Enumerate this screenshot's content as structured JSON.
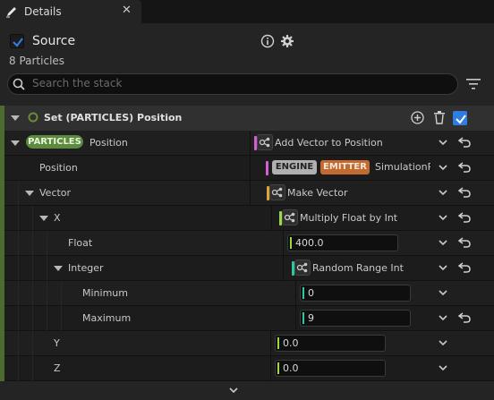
{
  "tab": {
    "label": "Details",
    "icon": "pencil-icon",
    "close": "✕"
  },
  "source": {
    "title": "Source",
    "subtitle": "8 Particles",
    "enabled": true
  },
  "toolbar": {
    "info_icon": "info-icon",
    "settings_icon": "gear-icon",
    "filter_icon": "filter-icon"
  },
  "search": {
    "placeholder": "Search the stack"
  },
  "module": {
    "title": "Set (PARTICLES) Position",
    "enabled": true
  },
  "rows": {
    "particles": {
      "tag": "PARTICLES",
      "label": "Position",
      "value": "Add Vector to Position"
    },
    "position": {
      "label": "Position",
      "tag_engine": "ENGINE",
      "tag_emitter": "EMITTER",
      "value": "SimulationP"
    },
    "vector": {
      "label": "Vector",
      "value": "Make Vector"
    },
    "x": {
      "label": "X",
      "value": "Multiply Float by Int"
    },
    "float": {
      "label": "Float",
      "value": "400.0"
    },
    "integer": {
      "label": "Integer",
      "value": "Random Range Int"
    },
    "minimum": {
      "label": "Minimum",
      "value": "0"
    },
    "maximum": {
      "label": "Maximum",
      "value": "9"
    },
    "y": {
      "label": "Y",
      "value": "0.0"
    },
    "z": {
      "label": "Z",
      "value": "0.0"
    }
  },
  "colors": {
    "accent_blue": "#2f7de1",
    "particles_pill": "#5c8a3e",
    "engine_tag": "#b0b0b0",
    "emitter_tag": "#c26a2f",
    "vector_bar": "#e0a33a",
    "float_bar": "#9ad84a",
    "int_bar": "#2fc6a6",
    "pink_bar": "#d35fd0"
  }
}
